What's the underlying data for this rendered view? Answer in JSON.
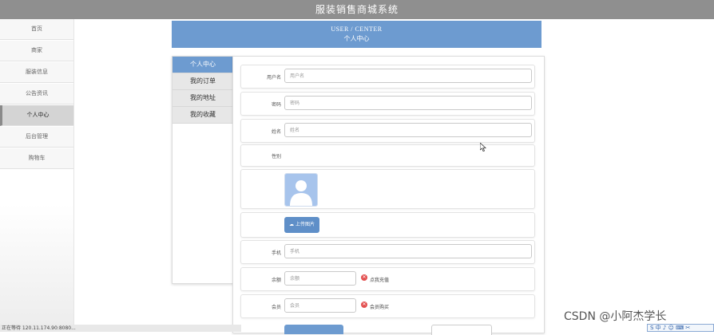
{
  "app": {
    "title": "服装销售商城系统"
  },
  "sidebar": {
    "items": [
      {
        "label": "首页"
      },
      {
        "label": "商家"
      },
      {
        "label": "服装信息"
      },
      {
        "label": "公告资讯"
      },
      {
        "label": "个人中心",
        "active": true
      },
      {
        "label": "后台管理"
      },
      {
        "label": "购物车"
      }
    ]
  },
  "header": {
    "title_en": "USER / CENTER",
    "title_cn": "个人中心"
  },
  "user_menu": {
    "items": [
      {
        "label": "个人中心",
        "active": true
      },
      {
        "label": "我的订单"
      },
      {
        "label": "我的地址"
      },
      {
        "label": "我的收藏"
      }
    ]
  },
  "form": {
    "username": {
      "label": "用户名",
      "placeholder": "用户名"
    },
    "password": {
      "label": "密码",
      "placeholder": "密码"
    },
    "name": {
      "label": "姓名",
      "placeholder": "姓名"
    },
    "gender": {
      "label": "性别"
    },
    "upload_label": "上传图片",
    "phone": {
      "label": "手机",
      "placeholder": "手机"
    },
    "balance": {
      "label": "余额",
      "placeholder": "余额",
      "action": "点我充值"
    },
    "member": {
      "label": "会员",
      "placeholder": "会员",
      "action": "会员购买"
    }
  },
  "statusbar": {
    "text": "正在等待 120.11.174.90:8080..."
  },
  "watermark": {
    "text": "CSDN @小阿杰学长"
  },
  "ime": {
    "text": "S 中 ♪ ☺ ⌨ ✂"
  },
  "colors": {
    "accent": "#6d9bd0",
    "topbar": "#8f8f8f",
    "warn": "#e35050"
  }
}
